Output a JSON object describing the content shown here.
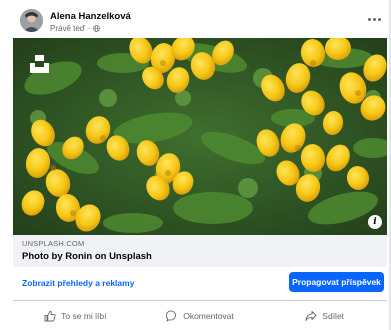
{
  "post": {
    "author": "Alena Hanzelková",
    "timestamp": "Právě teď",
    "visibility_icon": "globe-icon",
    "menu_icon": "more-options-icon"
  },
  "image": {
    "subject": "yellow bird's-foot trefoil flowers",
    "colors": {
      "flower": "#f3c515",
      "leaf": "#4e8a30",
      "background": "#2e5424"
    }
  },
  "link": {
    "domain": "UNSPLASH.COM",
    "title": "Photo by Ronin on Unsplash"
  },
  "cta": {
    "insights_label": "Zobrazit přehledy a reklamy",
    "promote_label": "Propagovat příspěvek"
  },
  "actions": {
    "like": "To se mi líbí",
    "comment": "Okomentovat",
    "share": "Sdílet"
  },
  "theme": {
    "accent": "#0866ff",
    "muted_text": "#65676b"
  }
}
